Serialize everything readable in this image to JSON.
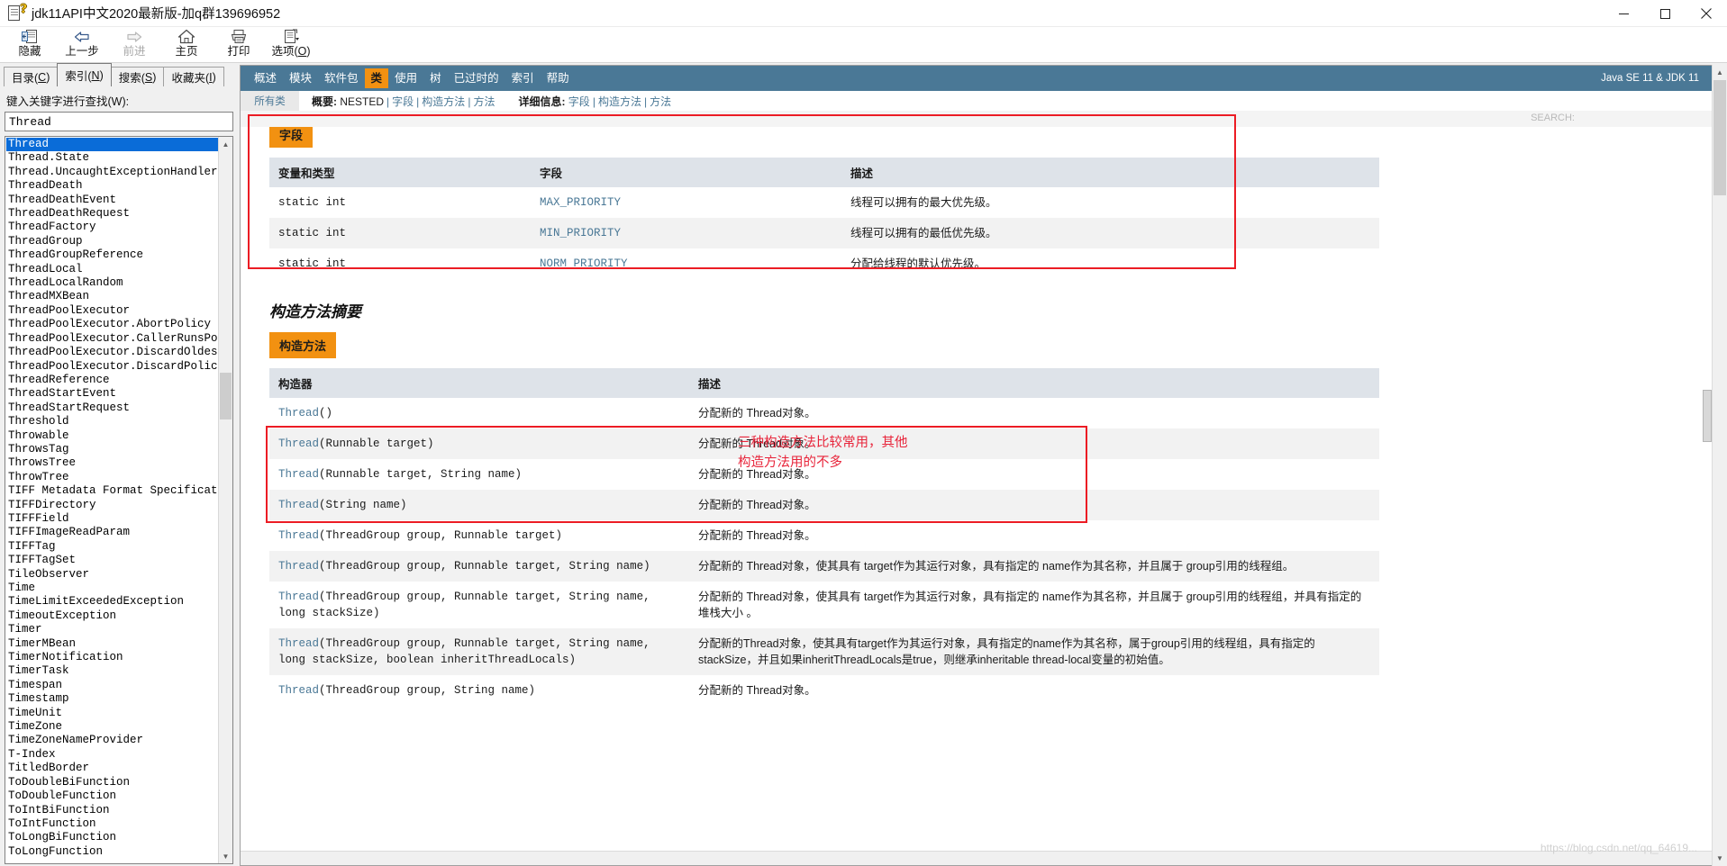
{
  "window": {
    "title": "jdk11API中文2020最新版-加q群139696952",
    "icon": "help-document-icon",
    "controls": {
      "minimize": "minimize-icon",
      "maximize": "maximize-icon",
      "close": "close-icon"
    }
  },
  "toolbar": [
    {
      "icon": "hide-pane-icon",
      "label": "隐藏",
      "disabled": false
    },
    {
      "icon": "back-arrow-icon",
      "label": "上一步",
      "disabled": false
    },
    {
      "icon": "forward-arrow-icon",
      "label": "前进",
      "disabled": true
    },
    {
      "icon": "home-icon",
      "label": "主页",
      "disabled": false
    },
    {
      "icon": "printer-icon",
      "label": "打印",
      "disabled": false
    },
    {
      "icon": "options-icon",
      "label": "选项(O)",
      "label_pre": "选项(",
      "label_accel": "O",
      "label_post": ")",
      "disabled": false
    }
  ],
  "left_pane": {
    "tabs": [
      {
        "label": "目录(C)",
        "pre": "目录(",
        "accel": "C",
        "post": ")",
        "active": false
      },
      {
        "label": "索引(N)",
        "pre": "索引(",
        "accel": "N",
        "post": ")",
        "active": true
      },
      {
        "label": "搜索(S)",
        "pre": "搜索(",
        "accel": "S",
        "post": ")",
        "active": false
      },
      {
        "label": "收藏夹(I)",
        "pre": "收藏夹(",
        "accel": "I",
        "post": ")",
        "active": false
      }
    ],
    "search_label": "键入关键字进行查找(W):",
    "search_value": "Thread",
    "list_selected": "Thread",
    "list_items": [
      "Thread",
      "Thread.State",
      "Thread.UncaughtExceptionHandler",
      "ThreadDeath",
      "ThreadDeathEvent",
      "ThreadDeathRequest",
      "ThreadFactory",
      "ThreadGroup",
      "ThreadGroupReference",
      "ThreadLocal",
      "ThreadLocalRandom",
      "ThreadMXBean",
      "ThreadPoolExecutor",
      "ThreadPoolExecutor.AbortPolicy",
      "ThreadPoolExecutor.CallerRunsPolicy",
      "ThreadPoolExecutor.DiscardOldestPolicy",
      "ThreadPoolExecutor.DiscardPolicy",
      "ThreadReference",
      "ThreadStartEvent",
      "ThreadStartRequest",
      "Threshold",
      "Throwable",
      "ThrowsTag",
      "ThrowsTree",
      "ThrowTree",
      "TIFF Metadata Format Specification",
      "TIFFDirectory",
      "TIFFField",
      "TIFFImageReadParam",
      "TIFFTag",
      "TIFFTagSet",
      "TileObserver",
      "Time",
      "TimeLimitExceededException",
      "TimeoutException",
      "Timer",
      "TimerMBean",
      "TimerNotification",
      "TimerTask",
      "Timespan",
      "Timestamp",
      "TimeUnit",
      "TimeZone",
      "TimeZoneNameProvider",
      "T-Index",
      "TitledBorder",
      "ToDoubleBiFunction",
      "ToDoubleFunction",
      "ToIntBiFunction",
      "ToIntFunction",
      "ToLongBiFunction",
      "ToLongFunction"
    ]
  },
  "doc": {
    "topnav": {
      "items": [
        "概述",
        "模块",
        "软件包",
        "类",
        "使用",
        "树",
        "已过时的",
        "索引",
        "帮助"
      ],
      "current": "类",
      "version": "Java SE 11 & JDK 11"
    },
    "subnav": {
      "all_classes": "所有类",
      "summary_label": "概要:",
      "summary_items": [
        "NESTED",
        "字段",
        "构造方法",
        "方法"
      ],
      "detail_label": "详细信息:",
      "detail_items": [
        "字段",
        "构造方法",
        "方法"
      ]
    },
    "fields_section": {
      "chip": "字段",
      "headers": [
        "变量和类型",
        "字段",
        "描述"
      ],
      "rows": [
        {
          "type": "static int",
          "name": "MAX_PRIORITY",
          "desc": "线程可以拥有的最大优先级。"
        },
        {
          "type": "static int",
          "name": "MIN_PRIORITY",
          "desc": "线程可以拥有的最低优先级。"
        },
        {
          "type": "static int",
          "name": "NORM_PRIORITY",
          "desc": "分配给线程的默认优先级。"
        }
      ]
    },
    "ctor_section": {
      "title": "构造方法摘要",
      "chip": "构造方法",
      "headers": [
        "构造器",
        "描述"
      ],
      "rows": [
        {
          "sig_link": "Thread",
          "sig_rest": "()",
          "desc": "分配新的 Thread对象。"
        },
        {
          "sig_link": "Thread",
          "sig_rest": "(Runnable target)",
          "desc": "分配新的 Thread对象。"
        },
        {
          "sig_link": "Thread",
          "sig_rest": "(Runnable target, String name)",
          "desc": "分配新的 Thread对象。"
        },
        {
          "sig_link": "Thread",
          "sig_rest": "(String name)",
          "desc": "分配新的 Thread对象。"
        },
        {
          "sig_link": "Thread",
          "sig_rest": "(ThreadGroup group, Runnable target)",
          "desc": "分配新的 Thread对象。"
        },
        {
          "sig_link": "Thread",
          "sig_rest": "(ThreadGroup group, Runnable target, String name)",
          "desc": "分配新的 Thread对象，使其具有 target作为其运行对象，具有指定的 name作为其名称，并且属于 group引用的线程组。"
        },
        {
          "sig_link": "Thread",
          "sig_rest": "(ThreadGroup group, Runnable target, String name, long stackSize)",
          "desc": "分配新的 Thread对象，使其具有 target作为其运行对象，具有指定的 name作为其名称，并且属于 group引用的线程组，并具有指定的 堆栈大小 。"
        },
        {
          "sig_link": "Thread",
          "sig_rest": "(ThreadGroup group, Runnable target, String name, long stackSize, boolean inheritThreadLocals)",
          "desc": "分配新的Thread对象，使其具有target作为其运行对象，具有指定的name作为其名称，属于group引用的线程组，具有指定的stackSize，并且如果inheritThreadLocals是true，则继承inheritable thread-local变量的初始值。"
        },
        {
          "sig_link": "Thread",
          "sig_rest": "(ThreadGroup group, String name)",
          "desc": "分配新的 Thread对象。"
        }
      ]
    },
    "annotation": "三种构造方法比较常用，其他构造方法用的不多",
    "watermark": "https://blog.csdn.net/qq_64619..."
  }
}
